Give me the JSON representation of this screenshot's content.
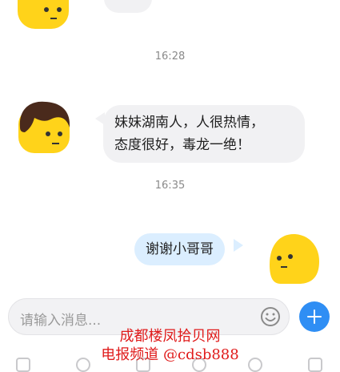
{
  "messages": [
    {
      "time": "16:28",
      "sender": "other",
      "text_line1": "妹妹湖南人，人很热情，",
      "text_line2": "态度很好，毒龙一绝！"
    },
    {
      "time": "16:35",
      "sender": "me",
      "text": "谢谢小哥哥"
    }
  ],
  "input": {
    "placeholder": "请输入消息..."
  },
  "watermark": {
    "line1": "成都楼凤拾贝网",
    "line2": "电报频道 @cdsb888"
  },
  "icons": {
    "emoji": "smiley-icon",
    "add": "plus-icon"
  },
  "colors": {
    "accent": "#2f8ef4",
    "avatar_yellow": "#ffd31a",
    "hair": "#4a2a1c",
    "watermark": "#e01b1b"
  }
}
